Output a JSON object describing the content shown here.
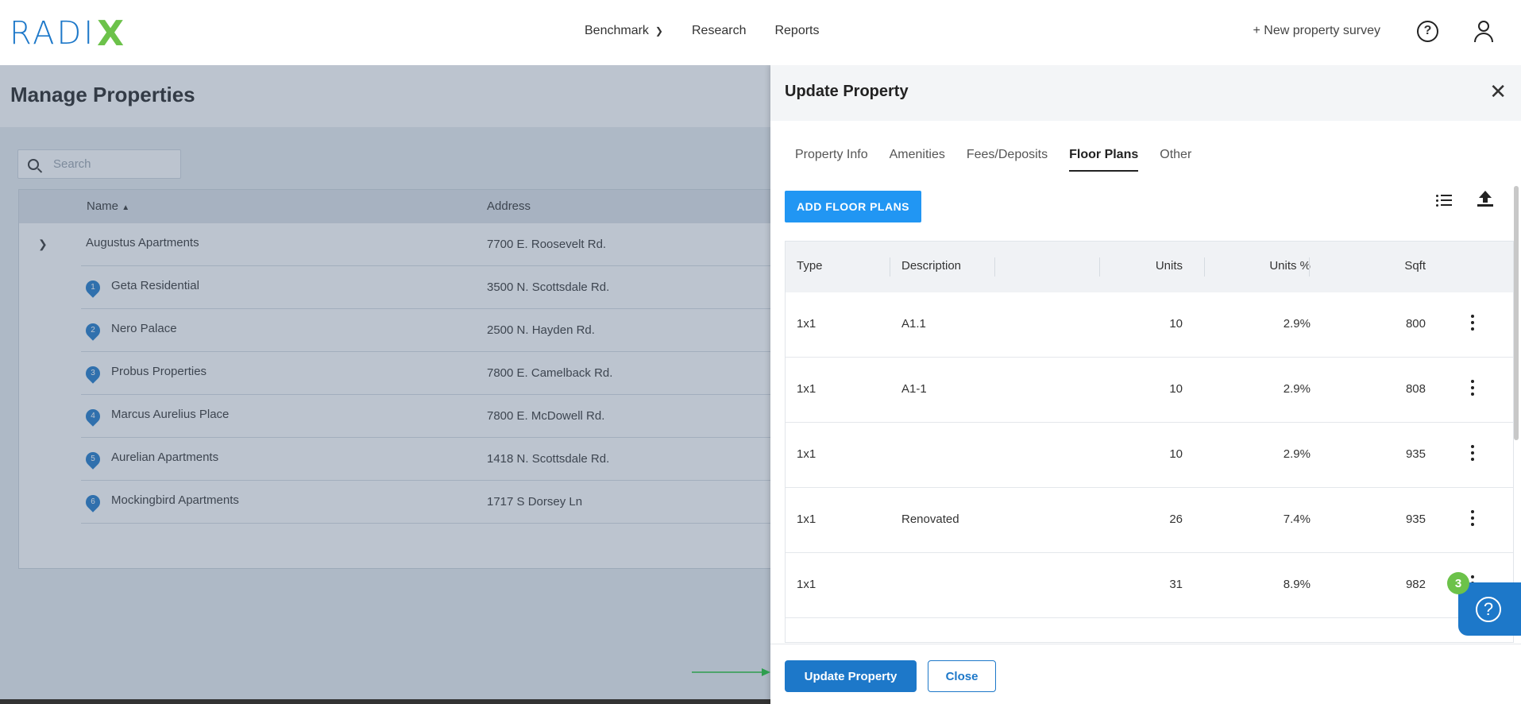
{
  "header": {
    "logo_text": "RADIX",
    "nav": [
      {
        "label": "Benchmark",
        "has_dropdown": true
      },
      {
        "label": "Research"
      },
      {
        "label": "Reports"
      }
    ],
    "new_survey_label": "+ New property survey"
  },
  "page": {
    "title": "Manage Properties",
    "search_placeholder": "Search",
    "columns": {
      "name": "Name",
      "address": "Address"
    },
    "group": {
      "name": "Augustus Apartments",
      "address": "7700 E. Roosevelt Rd."
    },
    "rows": [
      {
        "num": "1",
        "name": "Geta Residential",
        "address": "3500 N. Scottsdale Rd."
      },
      {
        "num": "2",
        "name": "Nero Palace",
        "address": "2500 N. Hayden Rd."
      },
      {
        "num": "3",
        "name": "Probus Properties",
        "address": "7800 E. Camelback Rd."
      },
      {
        "num": "4",
        "name": "Marcus Aurelius Place",
        "address": "7800 E. McDowell Rd."
      },
      {
        "num": "5",
        "name": "Aurelian Apartments",
        "address": "1418 N. Scottsdale Rd."
      },
      {
        "num": "6",
        "name": "Mockingbird Apartments",
        "address": "1717 S Dorsey Ln"
      }
    ]
  },
  "drawer": {
    "title": "Update Property",
    "tabs": [
      "Property Info",
      "Amenities",
      "Fees/Deposits",
      "Floor Plans",
      "Other"
    ],
    "active_tab": "Floor Plans",
    "add_button": "ADD FLOOR PLANS",
    "table_columns": [
      "Type",
      "Description",
      "Units",
      "Units %",
      "Sqft"
    ],
    "rows": [
      {
        "type": "1x1",
        "description": "A1.1",
        "units": "10",
        "units_pct": "2.9%",
        "sqft": "800"
      },
      {
        "type": "1x1",
        "description": "A1-1",
        "units": "10",
        "units_pct": "2.9%",
        "sqft": "808"
      },
      {
        "type": "1x1",
        "description": "",
        "units": "10",
        "units_pct": "2.9%",
        "sqft": "935"
      },
      {
        "type": "1x1",
        "description": "Renovated",
        "units": "26",
        "units_pct": "7.4%",
        "sqft": "935"
      },
      {
        "type": "1x1",
        "description": "",
        "units": "31",
        "units_pct": "8.9%",
        "sqft": "982"
      }
    ],
    "update_button": "Update Property",
    "close_button": "Close"
  },
  "help": {
    "badge_count": "3"
  },
  "colors": {
    "brand_blue": "#1d78c9",
    "brand_green": "#6cc24a",
    "action_blue": "#2196f3"
  }
}
